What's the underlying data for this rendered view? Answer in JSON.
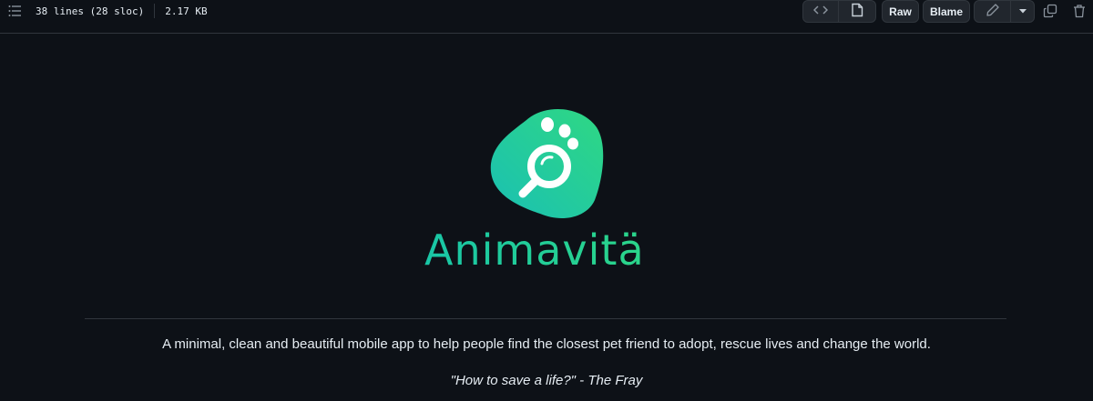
{
  "toolbar": {
    "lines_info": "38 lines (28 sloc)",
    "size_info": "2.17 KB",
    "raw_label": "Raw",
    "blame_label": "Blame",
    "icons": {
      "list": "list-icon",
      "code": "code-icon",
      "file": "file-icon",
      "edit": "pencil-icon",
      "dropdown": "triangle-down-icon",
      "copy": "copy-icon",
      "delete": "trash-icon"
    }
  },
  "readme": {
    "logo_text": "Animavitä",
    "description": "A minimal, clean and beautiful mobile app to help people find the closest pet friend to adopt, rescue lives and change the world.",
    "quote": "\"How to save a life?\" - The Fray"
  },
  "colors": {
    "background": "#0d1117",
    "border": "#30363d",
    "brand_start": "#19c6a6",
    "brand_end": "#2bd58a"
  }
}
